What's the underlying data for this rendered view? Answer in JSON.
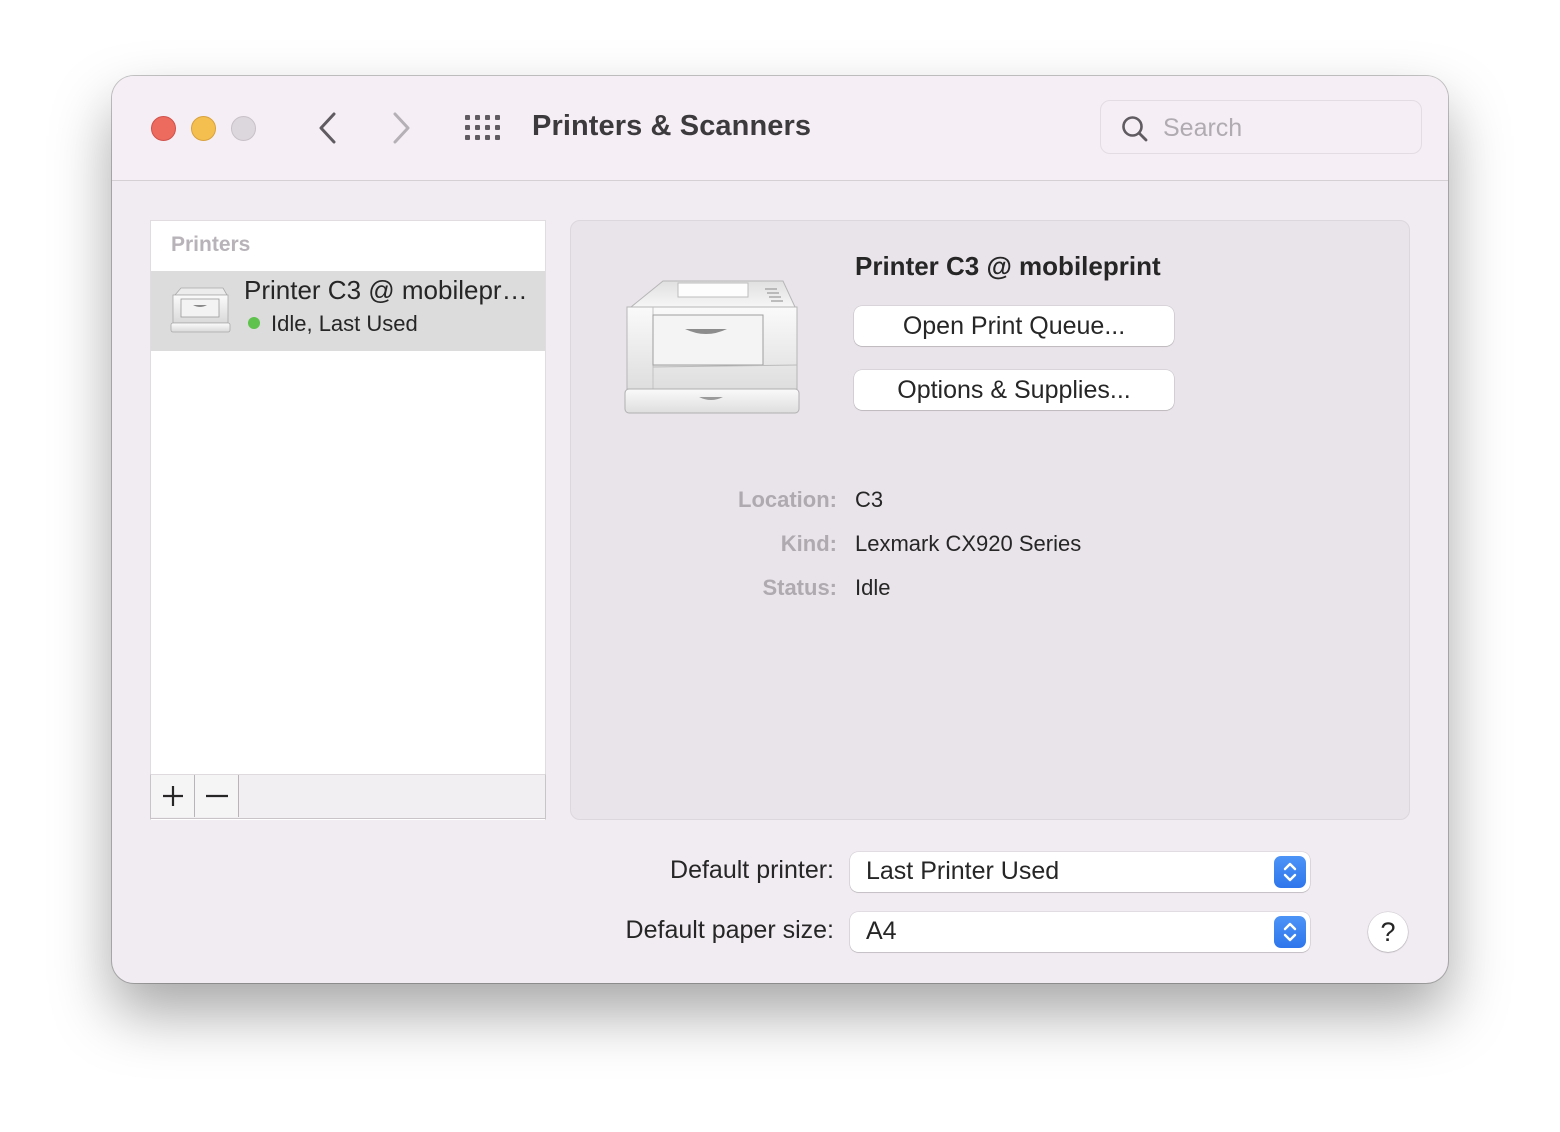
{
  "window": {
    "title": "Printers & Scanners",
    "search": {
      "placeholder": "Search",
      "value": ""
    }
  },
  "icons": {
    "close": "close-icon",
    "minimize": "minimize-icon",
    "zoom": "zoom-icon",
    "back": "chevron-left-icon",
    "forward": "chevron-right-icon",
    "show_all": "grid-icon",
    "search": "search-icon",
    "printer": "printer-icon",
    "add": "plus-icon",
    "remove": "minus-icon",
    "stepper": "chevron-up-down-icon",
    "help": "question-icon"
  },
  "printers_list": {
    "header": "Printers",
    "items": [
      {
        "name": "Printer C3 @ mobilepr…",
        "status": "Idle, Last Used",
        "status_color": "#5ec24d",
        "selected": true
      }
    ],
    "add_label": "+",
    "remove_label": "—"
  },
  "detail": {
    "printer_name": "Printer C3 @ mobileprint",
    "open_queue_label": "Open Print Queue...",
    "options_label": "Options & Supplies...",
    "info": [
      {
        "label": "Location:",
        "value": "C3"
      },
      {
        "label": "Kind:",
        "value": "Lexmark CX920 Series"
      },
      {
        "label": "Status:",
        "value": "Idle"
      }
    ]
  },
  "defaults": {
    "printer_label": "Default printer:",
    "printer_value": "Last Printer Used",
    "paper_label": "Default paper size:",
    "paper_value": "A4",
    "help_label": "?"
  },
  "colors": {
    "accent": "#3a84f2",
    "close": "#ec6a5e",
    "minimize": "#f4bf4f",
    "zoom_disabled": "#dcd7dc"
  }
}
